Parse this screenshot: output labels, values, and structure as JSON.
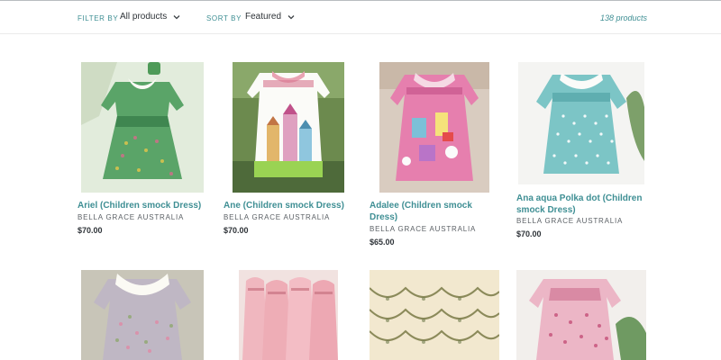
{
  "toolbar": {
    "filter_label": "FILTER BY",
    "filter_value": "All products",
    "sort_label": "SORT BY",
    "sort_value": "Featured",
    "product_count": "138 products"
  },
  "products": [
    {
      "title_line1": "Ariel (Children smock Dress)",
      "title_line2": "",
      "vendor": "BELLA GRACE AUSTRALIA",
      "price": "$70.00"
    },
    {
      "title_line1": "Ane (Children smock Dress)",
      "title_line2": "",
      "vendor": "BELLA GRACE AUSTRALIA",
      "price": "$70.00"
    },
    {
      "title_line1": "Adalee (Children smock",
      "title_line2": "Dress)",
      "vendor": "BELLA GRACE AUSTRALIA",
      "price": "$65.00"
    },
    {
      "title_line1": "Ana aqua Polka dot (Children",
      "title_line2": "smock Dress)",
      "vendor": "BELLA GRACE AUSTRALIA",
      "price": "$70.00"
    }
  ],
  "colors": {
    "accent": "#3f8f94",
    "text": "#2e3338",
    "muted": "#5c6166"
  }
}
